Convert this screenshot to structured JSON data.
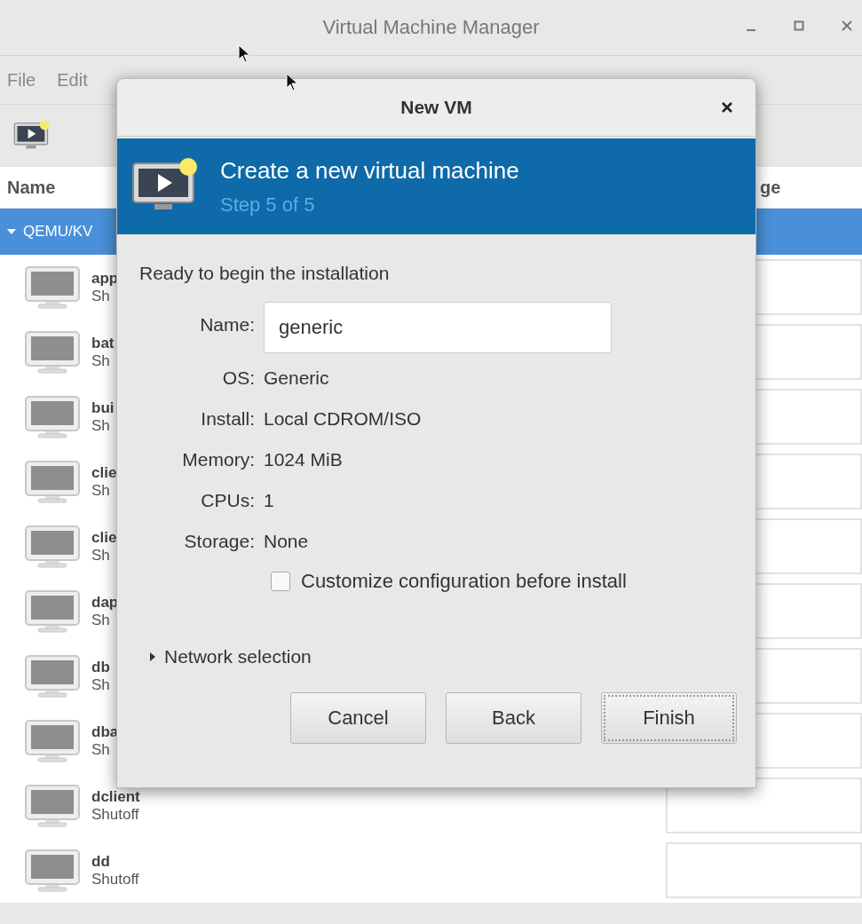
{
  "window": {
    "title": "Virtual Machine Manager"
  },
  "menu": [
    "File",
    "Edit"
  ],
  "table": {
    "columns": [
      "Name",
      "ge"
    ],
    "group": {
      "label": "QEMU/KV",
      "expanded": true,
      "selected": true
    },
    "rows": [
      {
        "name": "app",
        "status": "Sh"
      },
      {
        "name": "bat",
        "status": "Sh"
      },
      {
        "name": "bui",
        "status": "Sh"
      },
      {
        "name": "clie",
        "status": "Sh"
      },
      {
        "name": "clie",
        "status": "Sh"
      },
      {
        "name": "dap",
        "status": "Sh"
      },
      {
        "name": "db",
        "status": "Sh"
      },
      {
        "name": "dba",
        "status": "Sh"
      },
      {
        "name": "dclient",
        "status": "Shutoff"
      },
      {
        "name": "dd",
        "status": "Shutoff"
      }
    ]
  },
  "dialog": {
    "title": "New VM",
    "banner": {
      "title": "Create a new virtual machine",
      "step": "Step 5 of 5"
    },
    "heading": "Ready to begin the installation",
    "fields": [
      {
        "kind": "input",
        "label": "Name:",
        "value": "generic"
      },
      {
        "kind": "text",
        "label": "OS:",
        "value": "Generic"
      },
      {
        "kind": "text",
        "label": "Install:",
        "value": "Local CDROM/ISO"
      },
      {
        "kind": "text",
        "label": "Memory:",
        "value": "1024 MiB"
      },
      {
        "kind": "text",
        "label": "CPUs:",
        "value": "1"
      },
      {
        "kind": "text",
        "label": "Storage:",
        "value": "None"
      }
    ],
    "checkbox": {
      "label": "Customize configuration before install",
      "checked": false
    },
    "expander": {
      "label": "Network selection",
      "expanded": false
    },
    "buttons": [
      {
        "label": "Cancel",
        "focused": false
      },
      {
        "label": "Back",
        "focused": false
      },
      {
        "label": "Finish",
        "focused": true
      }
    ]
  }
}
